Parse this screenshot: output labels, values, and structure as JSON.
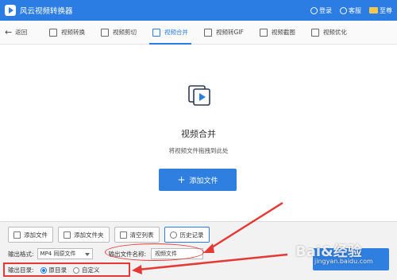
{
  "app": {
    "title": "风云视频转换器"
  },
  "titlebar": {
    "login": "登录",
    "service": "客服",
    "vip": "至尊"
  },
  "nav": {
    "back": "返回",
    "tabs": [
      {
        "label": "视频转换",
        "icon": "video-convert-icon"
      },
      {
        "label": "视频剪切",
        "icon": "video-cut-icon"
      },
      {
        "label": "视频合并",
        "icon": "video-merge-icon",
        "active": true
      },
      {
        "label": "视频转GIF",
        "icon": "gif-icon"
      },
      {
        "label": "视频截图",
        "icon": "screenshot-icon"
      },
      {
        "label": "视频优化",
        "icon": "optimize-icon"
      }
    ]
  },
  "main": {
    "title": "视频合并",
    "hint": "将视频文件拖拽到此处",
    "add_button": "添加文件"
  },
  "bottom": {
    "buttons": [
      "添加文件",
      "添加文件夹",
      "清空列表",
      "历史记录"
    ],
    "format_label": "输出格式:",
    "format_value": "MP4 同原文件",
    "filename_label": "输出文件名称:",
    "filename_value": "视频文件",
    "dir_label": "输出目录:",
    "dir_options": [
      "原目录",
      "自定义"
    ],
    "dir_selected": "原目录"
  },
  "watermark": {
    "brand": "Bai&经验",
    "url": "jingyan.baidu.com"
  },
  "colors": {
    "accent": "#2b7ce3",
    "annotation": "#e53935"
  }
}
